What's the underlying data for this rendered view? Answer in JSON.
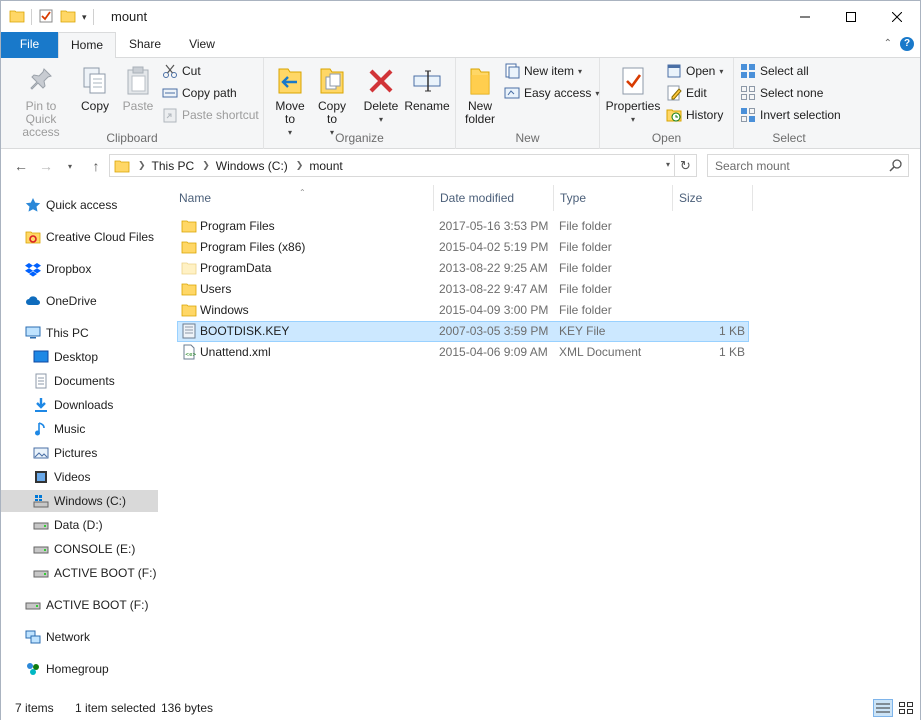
{
  "window": {
    "title": "mount"
  },
  "ribbon_tabs": {
    "file": "File",
    "home": "Home",
    "share": "Share",
    "view": "View"
  },
  "ribbon": {
    "clipboard": {
      "label": "Clipboard",
      "pin": "Pin to Quick access",
      "copy": "Copy",
      "paste": "Paste",
      "cut": "Cut",
      "copy_path": "Copy path",
      "paste_shortcut": "Paste shortcut"
    },
    "organize": {
      "label": "Organize",
      "move_to": "Move to",
      "copy_to": "Copy to",
      "delete": "Delete",
      "rename": "Rename"
    },
    "new": {
      "label": "New",
      "new_folder": "New folder",
      "new_item": "New item",
      "easy_access": "Easy access"
    },
    "open": {
      "label": "Open",
      "properties": "Properties",
      "open": "Open",
      "edit": "Edit",
      "history": "History"
    },
    "select": {
      "label": "Select",
      "select_all": "Select all",
      "select_none": "Select none",
      "invert_selection": "Invert selection"
    }
  },
  "address": {
    "crumbs": [
      "This PC",
      "Windows (C:)",
      "mount"
    ],
    "search_placeholder": "Search mount"
  },
  "nav": {
    "quick_access": "Quick access",
    "creative_cloud": "Creative Cloud Files",
    "dropbox": "Dropbox",
    "onedrive": "OneDrive",
    "this_pc": "This PC",
    "desktop": "Desktop",
    "documents": "Documents",
    "downloads": "Downloads",
    "music": "Music",
    "pictures": "Pictures",
    "videos": "Videos",
    "windows_c": "Windows (C:)",
    "data_d": "Data (D:)",
    "console_e": "CONSOLE (E:)",
    "active_boot_f_sub": "ACTIVE BOOT (F:)",
    "active_boot_f": "ACTIVE BOOT (F:)",
    "network": "Network",
    "homegroup": "Homegroup"
  },
  "columns": {
    "name": "Name",
    "date": "Date modified",
    "type": "Type",
    "size": "Size"
  },
  "files": [
    {
      "name": "Program Files",
      "date": "2017-05-16 3:53 PM",
      "type": "File folder",
      "size": "",
      "icon": "folder-icon"
    },
    {
      "name": "Program Files (x86)",
      "date": "2015-04-02 5:19 PM",
      "type": "File folder",
      "size": "",
      "icon": "folder-icon"
    },
    {
      "name": "ProgramData",
      "date": "2013-08-22 9:25 AM",
      "type": "File folder",
      "size": "",
      "icon": "folder-hidden-icon"
    },
    {
      "name": "Users",
      "date": "2013-08-22 9:47 AM",
      "type": "File folder",
      "size": "",
      "icon": "folder-icon"
    },
    {
      "name": "Windows",
      "date": "2015-04-09 3:00 PM",
      "type": "File folder",
      "size": "",
      "icon": "folder-icon"
    },
    {
      "name": "BOOTDISK.KEY",
      "date": "2007-03-05 3:59 PM",
      "type": "KEY File",
      "size": "1 KB",
      "icon": "key-file-icon",
      "selected": true
    },
    {
      "name": "Unattend.xml",
      "date": "2015-04-06 9:09 AM",
      "type": "XML Document",
      "size": "1 KB",
      "icon": "xml-file-icon"
    }
  ],
  "status": {
    "item_count": "7 items",
    "selection": "1 item selected",
    "size": "136 bytes"
  },
  "colors": {
    "accent": "#1979ca",
    "selection": "#cce8ff",
    "folder": "#ffd766"
  }
}
